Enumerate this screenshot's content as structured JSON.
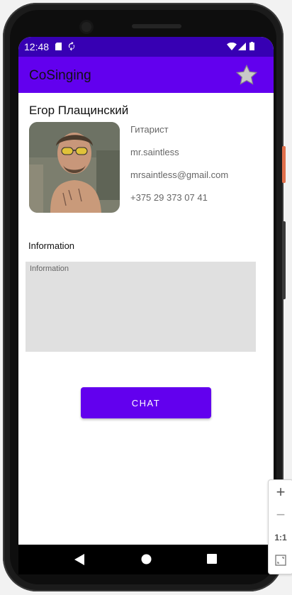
{
  "status_bar": {
    "time": "12:48"
  },
  "app_bar": {
    "title": "CoSinging"
  },
  "profile": {
    "name": "Егор Плащинский",
    "role": "Гитарист",
    "username": "mr.saintless",
    "email": "mrsaintless@gmail.com",
    "phone": "+375 29 373 07 41"
  },
  "info": {
    "label": "Information",
    "placeholder": "Information"
  },
  "chat_button": {
    "label": "CHAT"
  },
  "emulator_zoom": {
    "zoom_in": "+",
    "zoom_out": "−",
    "actual_size": "1:1"
  },
  "colors": {
    "primary": "#6200ee",
    "primary_dark": "#3700b3",
    "field_bg": "#e0e0e0"
  }
}
